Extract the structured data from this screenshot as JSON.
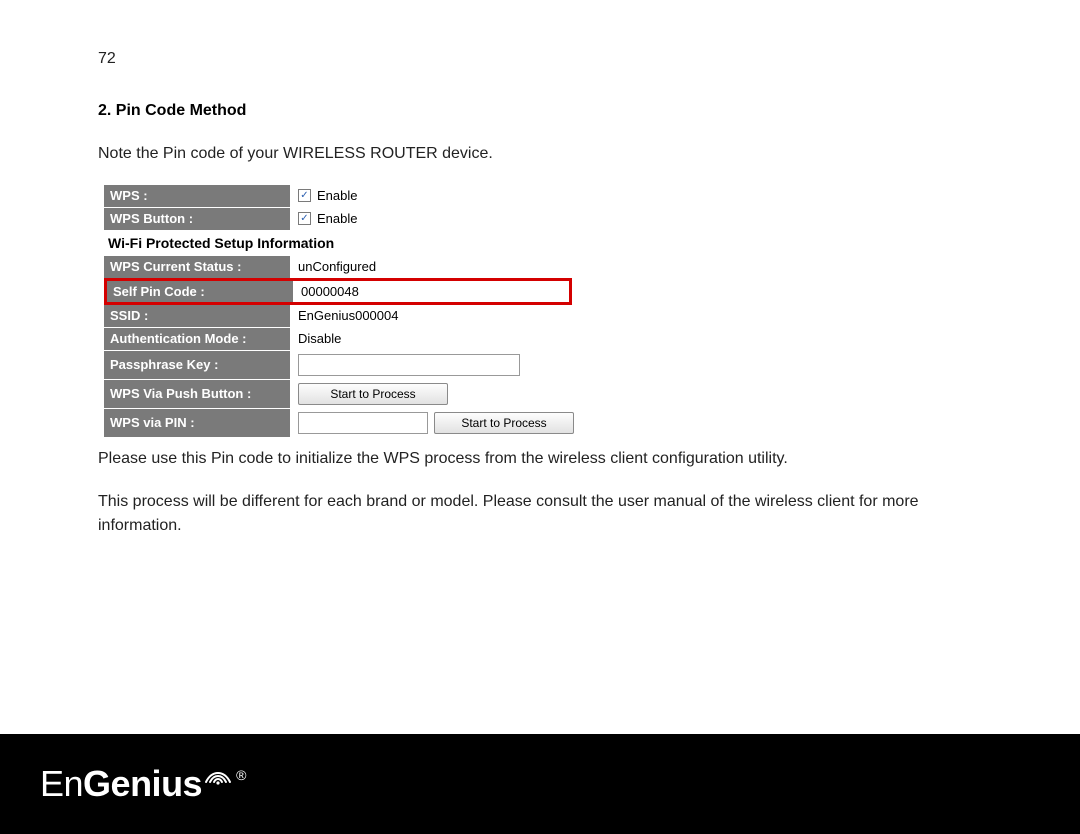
{
  "page_number": "72",
  "heading": "2.  Pin Code Method",
  "intro_text": "Note the Pin code of your WIRELESS ROUTER device.",
  "wps": {
    "enable_checkbox": {
      "wps_label": "WPS :",
      "wps_button_label": "WPS Button :",
      "enable_text": "Enable"
    },
    "section_title": "Wi-Fi Protected Setup Information",
    "rows": {
      "status_label": "WPS Current Status :",
      "status_value": "unConfigured",
      "pin_label": "Self Pin Code :",
      "pin_value": "00000048",
      "ssid_label": "SSID :",
      "ssid_value": "EnGenius000004",
      "auth_label": "Authentication Mode :",
      "auth_value": "Disable",
      "pass_label": "Passphrase Key :",
      "pass_value": "",
      "push_label": "WPS Via Push Button :",
      "push_btn": "Start to Process",
      "pin_via_label": "WPS via PIN :",
      "pin_via_value": "",
      "pin_via_btn": "Start to Process"
    }
  },
  "para2": "Please use this Pin code to initialize the WPS process from the wireless client configuration utility.",
  "para3": "This process will be different for each brand or model. Please consult the user manual of the wireless client for more information.",
  "brand": {
    "part1": "En",
    "part2": "Genius",
    "reg": "®"
  }
}
